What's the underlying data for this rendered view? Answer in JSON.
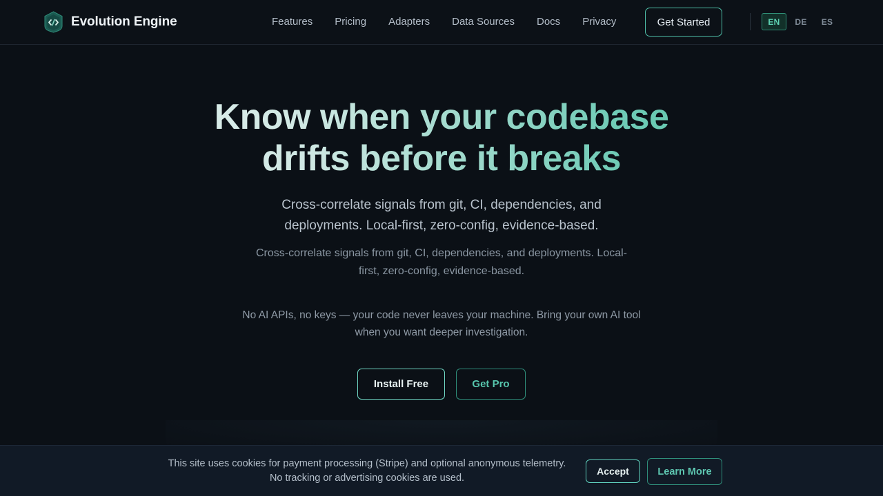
{
  "header": {
    "brand_name": "Evolution Engine",
    "nav": [
      {
        "label": "Features"
      },
      {
        "label": "Pricing"
      },
      {
        "label": "Adapters"
      },
      {
        "label": "Data Sources"
      },
      {
        "label": "Docs"
      },
      {
        "label": "Privacy"
      }
    ],
    "cta_label": "Get Started",
    "languages": [
      "EN",
      "DE",
      "ES"
    ],
    "active_language": "EN"
  },
  "hero": {
    "title_line1": "Know when your codebase",
    "title_line2": "drifts before it breaks",
    "subtitle_primary": "Cross-correlate signals from git, CI, dependencies, and deployments. Local-first, zero-config, evidence-based.",
    "subtitle_secondary": "Cross-correlate signals from git, CI, dependencies, and deployments. Local-first, zero-config, evidence-based.",
    "privacy_note": "No AI APIs, no keys — your code never leaves your machine. Bring your own AI tool when you want deeper investigation.",
    "install_label": "Install Free",
    "pro_label": "Get Pro"
  },
  "cookie_banner": {
    "line1": "This site uses cookies for payment processing (Stripe) and optional anonymous telemetry.",
    "line2": "No tracking or advertising cookies are used.",
    "accept_label": "Accept",
    "learn_more_label": "Learn More"
  },
  "colors": {
    "background": "#0b1016",
    "accent": "#4fbfa8",
    "accent_text": "#57c6ad"
  },
  "icons": {
    "logo": "shield-code-icon"
  }
}
